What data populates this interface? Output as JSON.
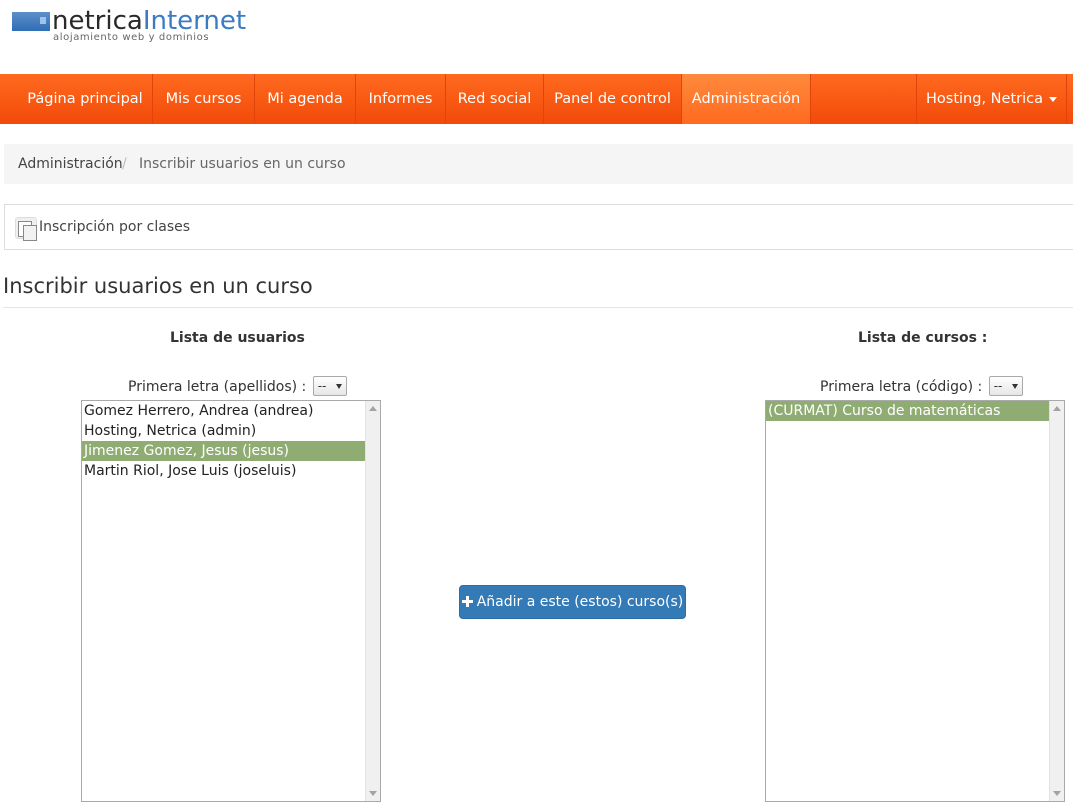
{
  "logo": {
    "name_part1": "netrica",
    "name_part2": "Internet",
    "tagline": "alojamiento web y dominios"
  },
  "nav": {
    "items": [
      {
        "label": "Página principal"
      },
      {
        "label": "Mis cursos"
      },
      {
        "label": "Mi agenda"
      },
      {
        "label": "Informes"
      },
      {
        "label": "Red social"
      },
      {
        "label": "Panel de control"
      },
      {
        "label": "Administración"
      }
    ],
    "active_item": "Administración",
    "user_menu_label": "Hosting, Netrica"
  },
  "breadcrumb": {
    "parent": "Administración",
    "separator": "/",
    "current": "Inscribir usuarios en un curso"
  },
  "actions": {
    "class_enrollment_label": "Inscripción por clases"
  },
  "page_title": "Inscribir usuarios en un curso",
  "users_panel": {
    "heading": "Lista de usuarios",
    "filter_label": "Primera letra (apellidos) :",
    "filter_value": "--",
    "options": [
      {
        "label": "Gomez Herrero, Andrea (andrea)",
        "selected": false
      },
      {
        "label": "Hosting, Netrica (admin)",
        "selected": false
      },
      {
        "label": "Jimenez Gomez, Jesus (jesus)",
        "selected": true
      },
      {
        "label": "Martin Riol, Jose Luis (joseluis)",
        "selected": false
      }
    ]
  },
  "courses_panel": {
    "heading": "Lista de cursos :",
    "filter_label": "Primera letra (código) :",
    "filter_value": "--",
    "options": [
      {
        "label": "(CURMAT) Curso de matemáticas",
        "selected": true
      }
    ]
  },
  "add_button": {
    "label": "Añadir a este (estos) curso(s)"
  },
  "colors": {
    "nav_orange": "#f24a09",
    "selected_option": "#8fac73",
    "primary_button": "#337ab7",
    "logo_blue": "#3b7bc4"
  }
}
